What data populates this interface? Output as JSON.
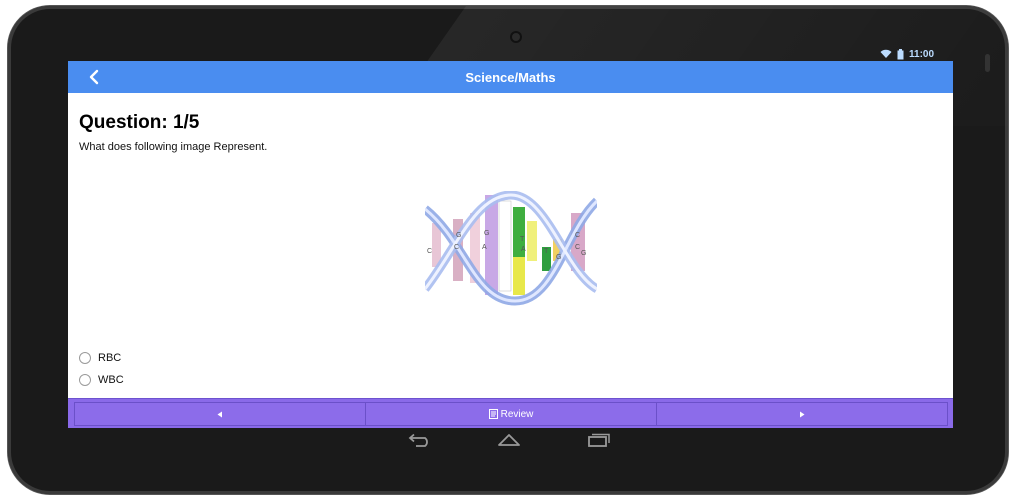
{
  "status": {
    "time": "11:00",
    "icons": [
      "wifi-icon",
      "battery-icon"
    ]
  },
  "appbar": {
    "title": "Science/Maths",
    "back_icon": "chevron-left-icon"
  },
  "question": {
    "title": "Question: 1/5",
    "text": "What does following image Represent.",
    "image": "dna-double-helix",
    "image_letters": [
      "C",
      "G",
      "C",
      "G",
      "A",
      "T",
      "A",
      "T",
      "G",
      "C",
      "C",
      "G"
    ],
    "options": [
      {
        "label": "RBC",
        "selected": false
      },
      {
        "label": "WBC",
        "selected": false
      }
    ]
  },
  "bottombar": {
    "prev_icon": "triangle-left-icon",
    "review_icon": "review-icon",
    "review_label": "Review",
    "next_icon": "triangle-right-icon"
  },
  "system_nav": [
    "back-icon",
    "home-icon",
    "recents-icon"
  ],
  "colors": {
    "appbar": "#4a8df0",
    "bottombar": "#8a6ae9",
    "bezel": "#1a1a1a"
  }
}
